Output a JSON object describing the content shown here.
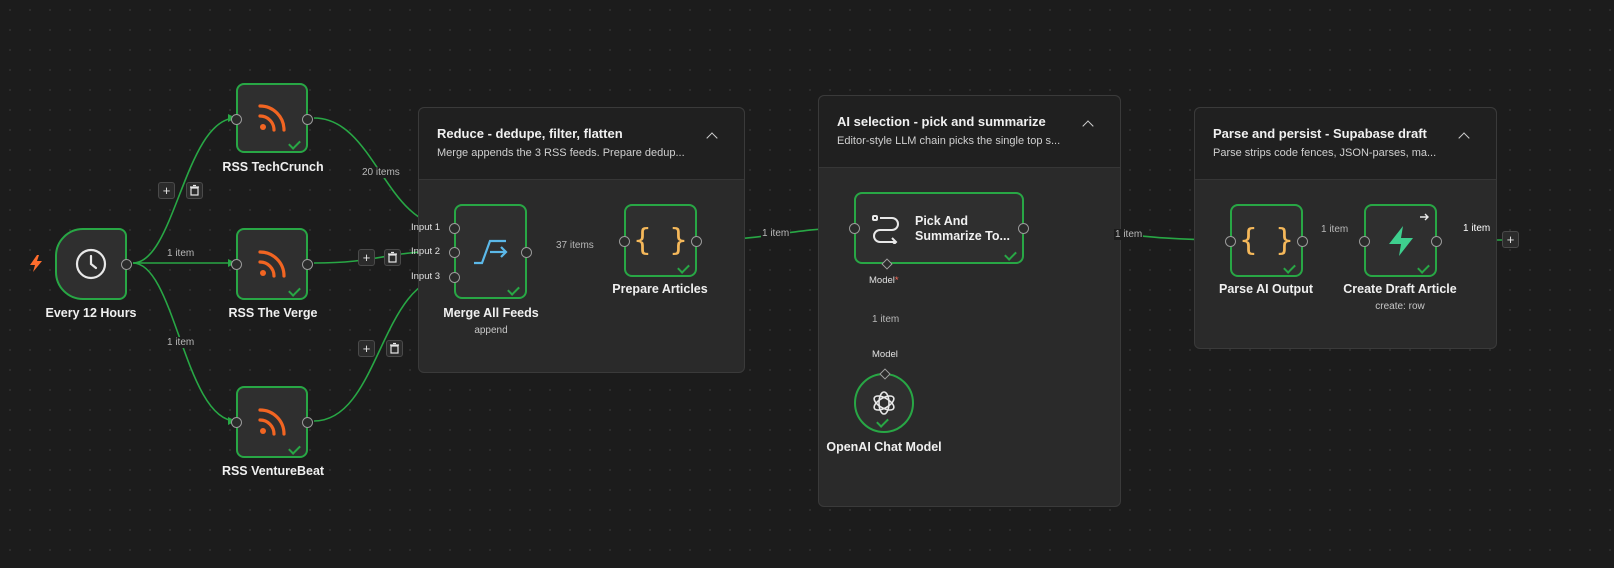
{
  "groups": [
    {
      "title": "Reduce - dedupe, filter, flatten",
      "description": "Merge appends the 3 RSS feeds. Prepare dedup..."
    },
    {
      "title": "AI selection - pick and summarize",
      "description": "Editor-style LLM chain picks the single top s..."
    },
    {
      "title": "Parse and persist - Supabase draft",
      "description": "Parse strips code fences, JSON-parses, ma..."
    }
  ],
  "nodes": {
    "schedule": {
      "label": "Every 12 Hours",
      "icon": "clock-icon"
    },
    "rss_techcrunch": {
      "label": "RSS TechCrunch",
      "icon": "rss-icon"
    },
    "rss_verge": {
      "label": "RSS The Verge",
      "icon": "rss-icon"
    },
    "rss_venturebeat": {
      "label": "RSS VentureBeat",
      "icon": "rss-icon"
    },
    "merge": {
      "label": "Merge All Feeds",
      "sublabel": "append",
      "icon": "merge-icon",
      "inputs": [
        "Input 1",
        "Input 2",
        "Input 3"
      ]
    },
    "prepare": {
      "label": "Prepare Articles",
      "icon": "code-braces-icon"
    },
    "pick": {
      "label": "Pick And Summarize To...",
      "icon": "chain-icon",
      "port_label": "Model",
      "required_mark": "*"
    },
    "openai": {
      "label": "OpenAI Chat Model",
      "icon": "openai-icon",
      "port_label": "Model"
    },
    "parse": {
      "label": "Parse AI Output",
      "icon": "code-braces-icon"
    },
    "create": {
      "label": "Create Draft Article",
      "sublabel": "create: row",
      "icon": "supabase-icon"
    }
  },
  "edges": {
    "schedule_to_techcrunch": "",
    "schedule_to_verge": "1 item",
    "schedule_to_venturebeat": "1 item",
    "techcrunch_to_merge": "20 items",
    "merge_to_prepare": "37 items",
    "prepare_to_pick": "1 item",
    "openai_to_pick": "1 item",
    "pick_to_parse": "1 item",
    "parse_to_create": "1 item",
    "create_out": "1 item"
  },
  "toolbar_buttons": {
    "add": "+",
    "delete_icon": "trash-icon"
  },
  "colors": {
    "canvas": "#1c1c1c",
    "success": "#28a745",
    "rss": "#f26522",
    "code": "#f5b85a",
    "merge": "#5bb8e8",
    "supabase": "#3ecf8e",
    "trigger_bolt": "#ff6d2d"
  }
}
